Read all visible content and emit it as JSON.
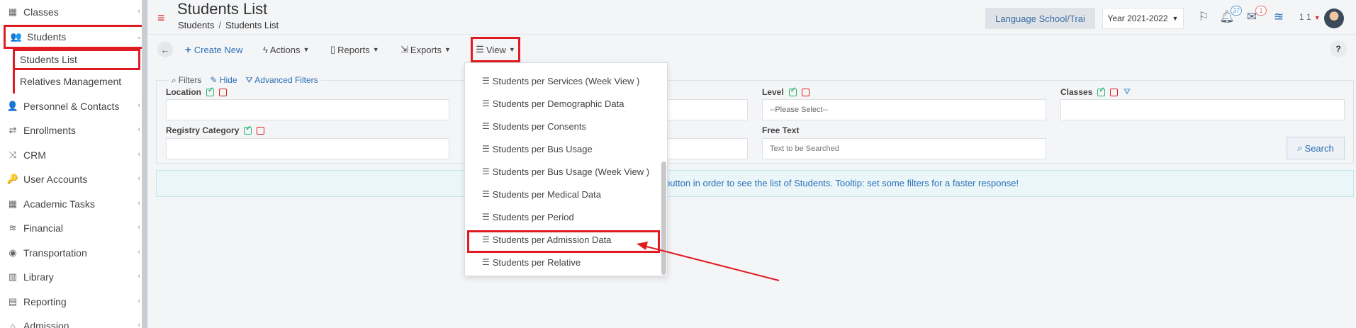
{
  "sidebar": {
    "items": [
      {
        "label": "Classes",
        "icon": "classes-icon"
      },
      {
        "label": "Students",
        "icon": "students-icon"
      },
      {
        "label": "Personnel & Contacts",
        "icon": "personnel-icon"
      },
      {
        "label": "Enrollments",
        "icon": "enrollments-icon"
      },
      {
        "label": "CRM",
        "icon": "crm-icon"
      },
      {
        "label": "User Accounts",
        "icon": "user-accounts-icon"
      },
      {
        "label": "Academic Tasks",
        "icon": "academic-tasks-icon"
      },
      {
        "label": "Financial",
        "icon": "financial-icon"
      },
      {
        "label": "Transportation",
        "icon": "transportation-icon"
      },
      {
        "label": "Library",
        "icon": "library-icon"
      },
      {
        "label": "Reporting",
        "icon": "reporting-icon"
      },
      {
        "label": "Admission",
        "icon": "admission-icon"
      }
    ],
    "sub_items": [
      {
        "label": "Students List"
      },
      {
        "label": "Relatives Management"
      }
    ]
  },
  "header": {
    "title": "Students List",
    "breadcrumb": [
      "Students",
      "Students List"
    ],
    "school": "Language School/Trai",
    "year": "Year 2021-2022",
    "notifications_count": "37",
    "messages_count": "1",
    "user_label": "1 1"
  },
  "toolbar": {
    "create_new": "Create New",
    "actions": "Actions",
    "reports": "Reports",
    "exports": "Exports",
    "view": "View",
    "help": "?"
  },
  "filters": {
    "title": "Filters",
    "hide": "Hide",
    "advanced": "Advanced Filters",
    "location_label": "Location",
    "level_label": "Level",
    "level_value": "--Please Select--",
    "classes_label": "Classes",
    "registry_label": "Registry Category",
    "free_text_label": "Free Text",
    "free_text_placeholder": "Text to be Searched",
    "search_button": "Search"
  },
  "info": {
    "message": "button in order to see the list of Students. Tooltip: set some filters for a faster response!"
  },
  "view_menu": {
    "items": [
      "Students per Services (Week View )",
      "Students per Demographic Data",
      "Students per Consents",
      "Students per Bus Usage",
      "Students per Bus Usage (Week View )",
      "Students per Medical Data",
      "Students per Period",
      "Students per Admission Data",
      "Students per Relative"
    ]
  },
  "colors": {
    "accent": "#2c6fb7",
    "highlight": "#e11b22",
    "info_bg": "#eaf6f8"
  }
}
